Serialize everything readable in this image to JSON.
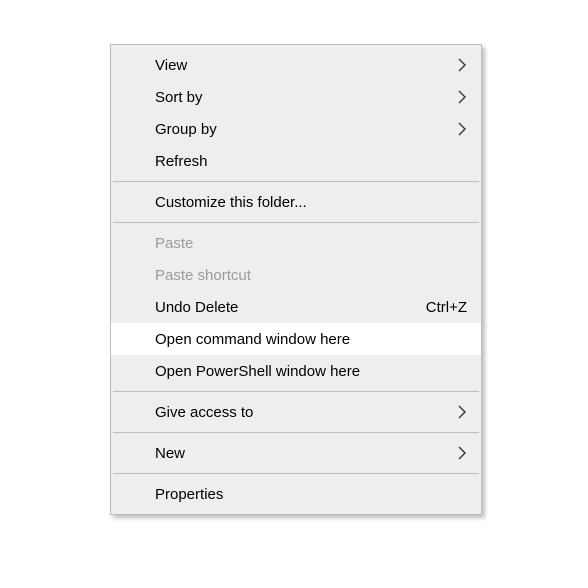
{
  "menu": {
    "items": [
      {
        "label": "View",
        "has_submenu": true
      },
      {
        "label": "Sort by",
        "has_submenu": true
      },
      {
        "label": "Group by",
        "has_submenu": true
      },
      {
        "label": "Refresh"
      },
      {
        "separator": true
      },
      {
        "label": "Customize this folder..."
      },
      {
        "separator": true
      },
      {
        "label": "Paste",
        "disabled": true
      },
      {
        "label": "Paste shortcut",
        "disabled": true
      },
      {
        "label": "Undo Delete",
        "shortcut": "Ctrl+Z"
      },
      {
        "label": "Open command window here",
        "highlight": true
      },
      {
        "label": "Open PowerShell window here"
      },
      {
        "separator": true
      },
      {
        "label": "Give access to",
        "has_submenu": true
      },
      {
        "separator": true
      },
      {
        "label": "New",
        "has_submenu": true
      },
      {
        "separator": true
      },
      {
        "label": "Properties"
      }
    ]
  }
}
